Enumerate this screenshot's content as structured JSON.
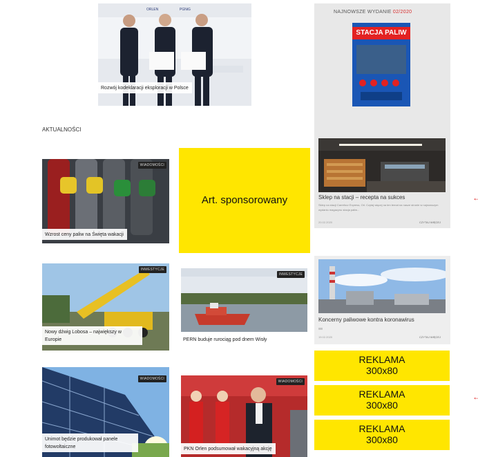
{
  "hero": {
    "caption": "Rozwój kodeklaracji eksploracji w Polsce",
    "banner_left": "ORLEN",
    "banner_right": "PGNiG"
  },
  "section": {
    "title": "AKTUALNOŚCI"
  },
  "sponsored": {
    "label": "Art. sponsorowany"
  },
  "sidebar": {
    "issue_label": "NAJNOWSZE WYDANIE",
    "issue_number": "02/2020",
    "magazine_title": "STACJA PALIW",
    "article_title": "Sklep na stacji – recepta na sukces",
    "article_excerpt": "Sklep na stacji Carrefour Express, Orl. Czytaj więcej na ten temat na nasze stronie w najnowszym wydaniu magazynu stacja paliw...",
    "article_date": "20.02.2020",
    "read_more": "CZYTAJ WIĘCEJ"
  },
  "sidebar_card2": {
    "title": "Koncerny paliwowe kontra koronawirus",
    "date": "19.02.2020",
    "read_more": "CZYTAJ WIĘCEJ"
  },
  "news": [
    {
      "caption": "Wzrost ceny paliw na Święta wakacji",
      "badge": "WIADOMOŚCI"
    },
    {
      "caption": "Nowy dźwig Lobosa – największy w Europie",
      "badge": "INWESTYCJE"
    },
    {
      "caption": "PERN buduje rurociąg pod dnem Wisły",
      "badge": "INWESTYCJE"
    },
    {
      "caption": "Unimot będzie produkował panele fotowoltaiczne",
      "badge": "WIADOMOŚCI"
    },
    {
      "caption": "PKN Orlen podsumował wakacyjną akcję",
      "badge": "WIADOMOŚCI"
    }
  ],
  "ads": [
    {
      "line1": "REKLAMA",
      "line2": "300x80"
    },
    {
      "line1": "REKLAMA",
      "line2": "300x80"
    },
    {
      "line1": "REKLAMA",
      "line2": "300x80"
    }
  ],
  "colors": {
    "ad_yellow": "#ffe600",
    "accent_red": "#e02a2a"
  }
}
